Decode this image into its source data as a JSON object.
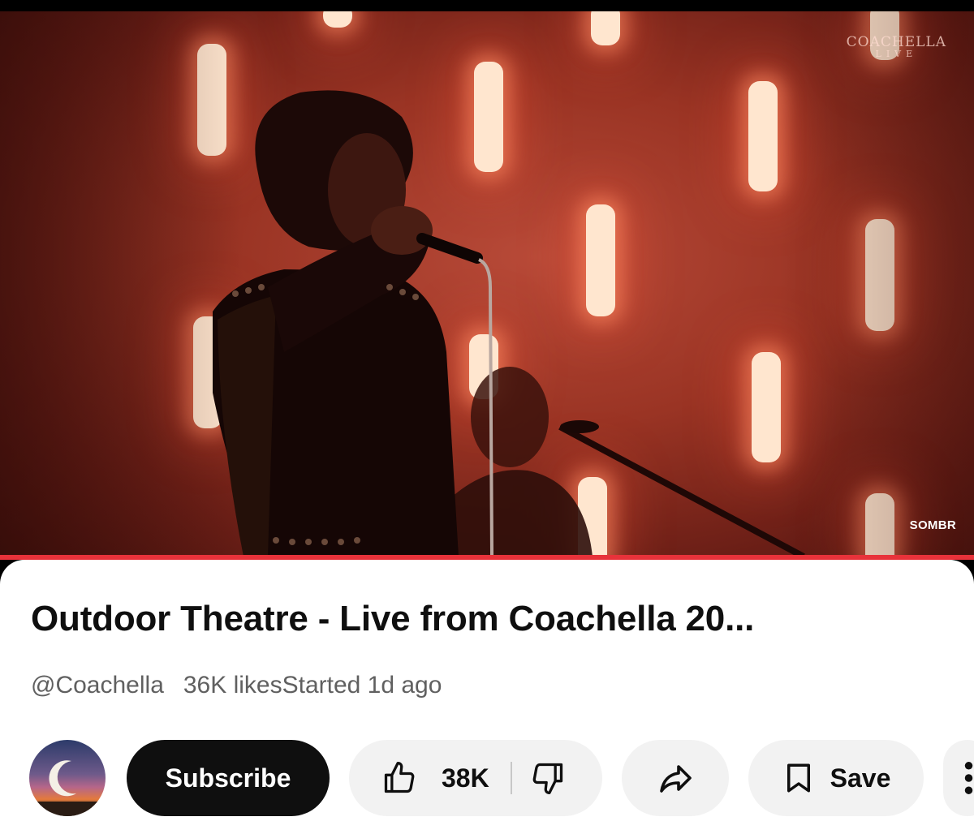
{
  "video": {
    "watermark_main": "COACHELLA",
    "watermark_sub": "LIVE",
    "artist_tag": "SOMBR",
    "progress_fraction": 1.0,
    "colors": {
      "progress": "#e8323a",
      "stage": "#9a3424"
    }
  },
  "details": {
    "title": "Outdoor Theatre - Live from Coachella 20...",
    "channel": "@Coachella",
    "likes_text": "36K likes",
    "started_text": "Started 1d ago"
  },
  "actions": {
    "subscribe_label": "Subscribe",
    "like_count": "38K",
    "save_label": "Save",
    "icons": [
      "thumbs-up-icon",
      "thumbs-down-icon",
      "share-icon",
      "bookmark-icon",
      "more-icon"
    ]
  }
}
